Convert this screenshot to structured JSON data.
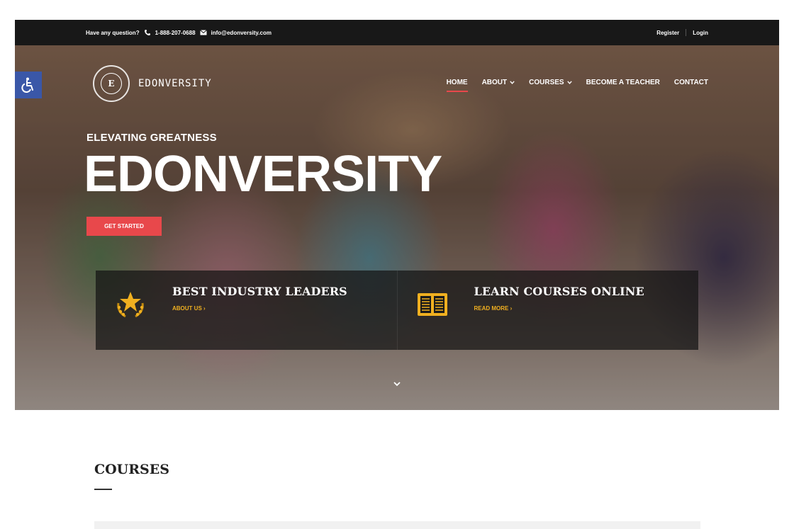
{
  "topbar": {
    "question": "Have any question?",
    "phone": "1-888-207-0688",
    "email": "info@edonversity.com",
    "register": "Register",
    "login": "Login"
  },
  "hero": {
    "logo_letter": "E",
    "logo_text": "EDONVERSITY",
    "nav": [
      {
        "label": "HOME",
        "active": true
      },
      {
        "label": "ABOUT",
        "dropdown": true
      },
      {
        "label": "COURSES",
        "dropdown": true
      },
      {
        "label": "BECOME A TEACHER"
      },
      {
        "label": "CONTACT"
      }
    ],
    "tagline": "ELEVATING GREATNESS",
    "title": "EDONVERSITY",
    "cta": "GET STARTED",
    "features": [
      {
        "title": "BEST INDUSTRY LEADERS",
        "link": "ABOUT US",
        "icon": "star-laurel-icon"
      },
      {
        "title": "LEARN COURSES ONLINE",
        "link": "READ MORE",
        "icon": "book-icon"
      }
    ]
  },
  "courses": {
    "title": "COURSES"
  },
  "colors": {
    "accent": "#e8484b",
    "gold": "#f0b020",
    "topbar": "#181818",
    "accessibility": "#3a57a8"
  }
}
